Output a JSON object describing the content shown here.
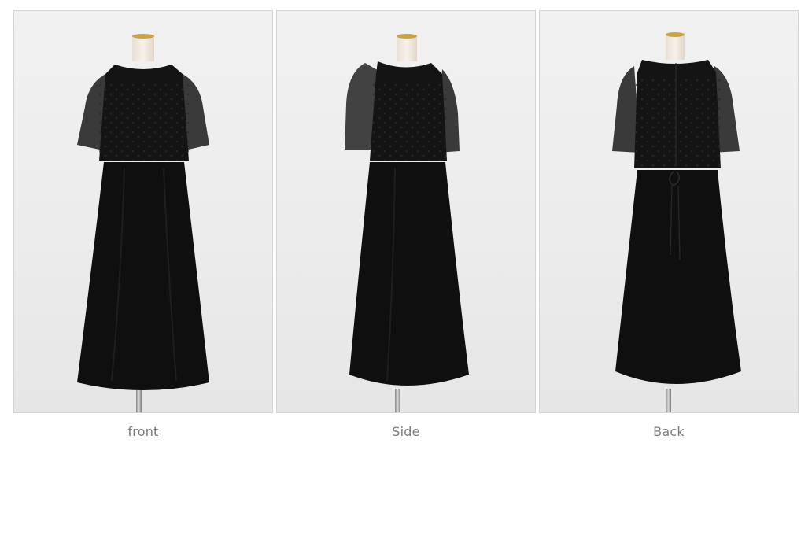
{
  "colors": {
    "background": "#ffffff",
    "photo_background": "#eeeeee",
    "photo_border": "#d4d4d4",
    "caption_text": "#7a7a7a",
    "dress": "#111111"
  },
  "gallery": {
    "panels": [
      {
        "caption": "front",
        "view": "front"
      },
      {
        "caption": "Side",
        "view": "side"
      },
      {
        "caption": "Back",
        "view": "back"
      }
    ]
  }
}
